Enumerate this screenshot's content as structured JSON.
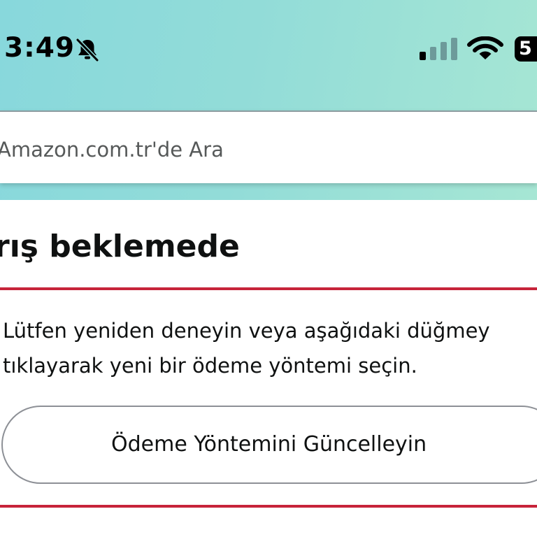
{
  "status_bar": {
    "time": "3:49",
    "battery": "5"
  },
  "search": {
    "placeholder": "Amazon.com.tr'de Ara"
  },
  "notice": {
    "title": "rış beklemede",
    "message_line_1": "Lütfen yeniden deneyin veya aşağıdaki düğmey",
    "message_line_2": "tıklayarak yeni bir ödeme yöntemi seçin.",
    "button_label": "Ödeme Yöntemini Güncelleyin"
  },
  "colors": {
    "accent_divider": "#c7243a",
    "header_gradient_start": "#88d8dc",
    "header_gradient_end": "#a6e6d4"
  }
}
